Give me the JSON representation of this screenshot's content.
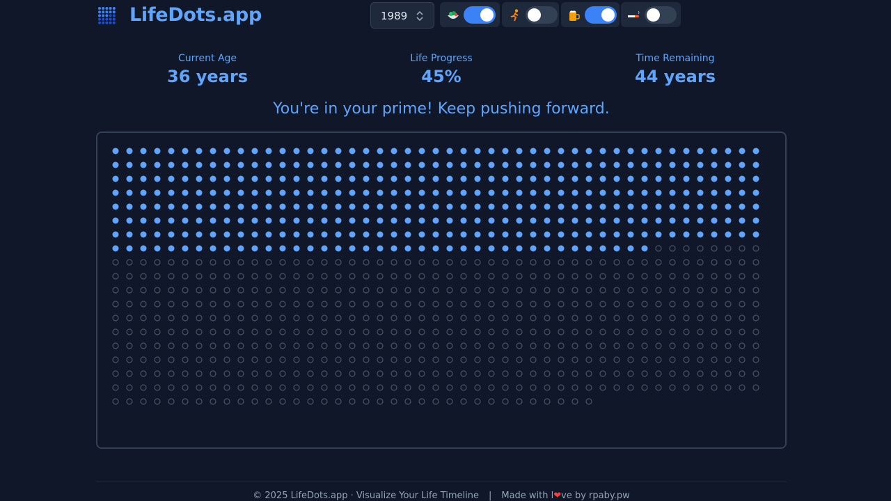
{
  "header": {
    "brand": "LifeDots.app",
    "birth_year": "1989",
    "toggles": [
      {
        "name": "healthy-diet",
        "icon": "salad-icon",
        "on": true
      },
      {
        "name": "exercise",
        "icon": "runner-icon",
        "on": false
      },
      {
        "name": "alcohol",
        "icon": "beer-icon",
        "on": true
      },
      {
        "name": "smoking",
        "icon": "cigarette-icon",
        "on": false
      }
    ]
  },
  "stats": {
    "current_age": {
      "label": "Current Age",
      "value": "36 years"
    },
    "life_progress": {
      "label": "Life Progress",
      "value": "45%"
    },
    "time_remaining": {
      "label": "Time Remaining",
      "value": "44 years"
    }
  },
  "message": "You're in your prime! Keep pushing forward.",
  "dots": {
    "total": 881,
    "filled": 368,
    "per_row": 47
  },
  "colors": {
    "accent": "#60a5fa",
    "background": "#0f1729",
    "empty_dot": "#475569",
    "toggle_on": "#3b82f6"
  },
  "footer": {
    "copyright": "© 2025 LifeDots.app · Visualize Your Life Timeline",
    "separator": "|",
    "made_with_prefix": "Made with l",
    "made_with_suffix": "ve by rpaby.pw",
    "heart": "❤"
  }
}
